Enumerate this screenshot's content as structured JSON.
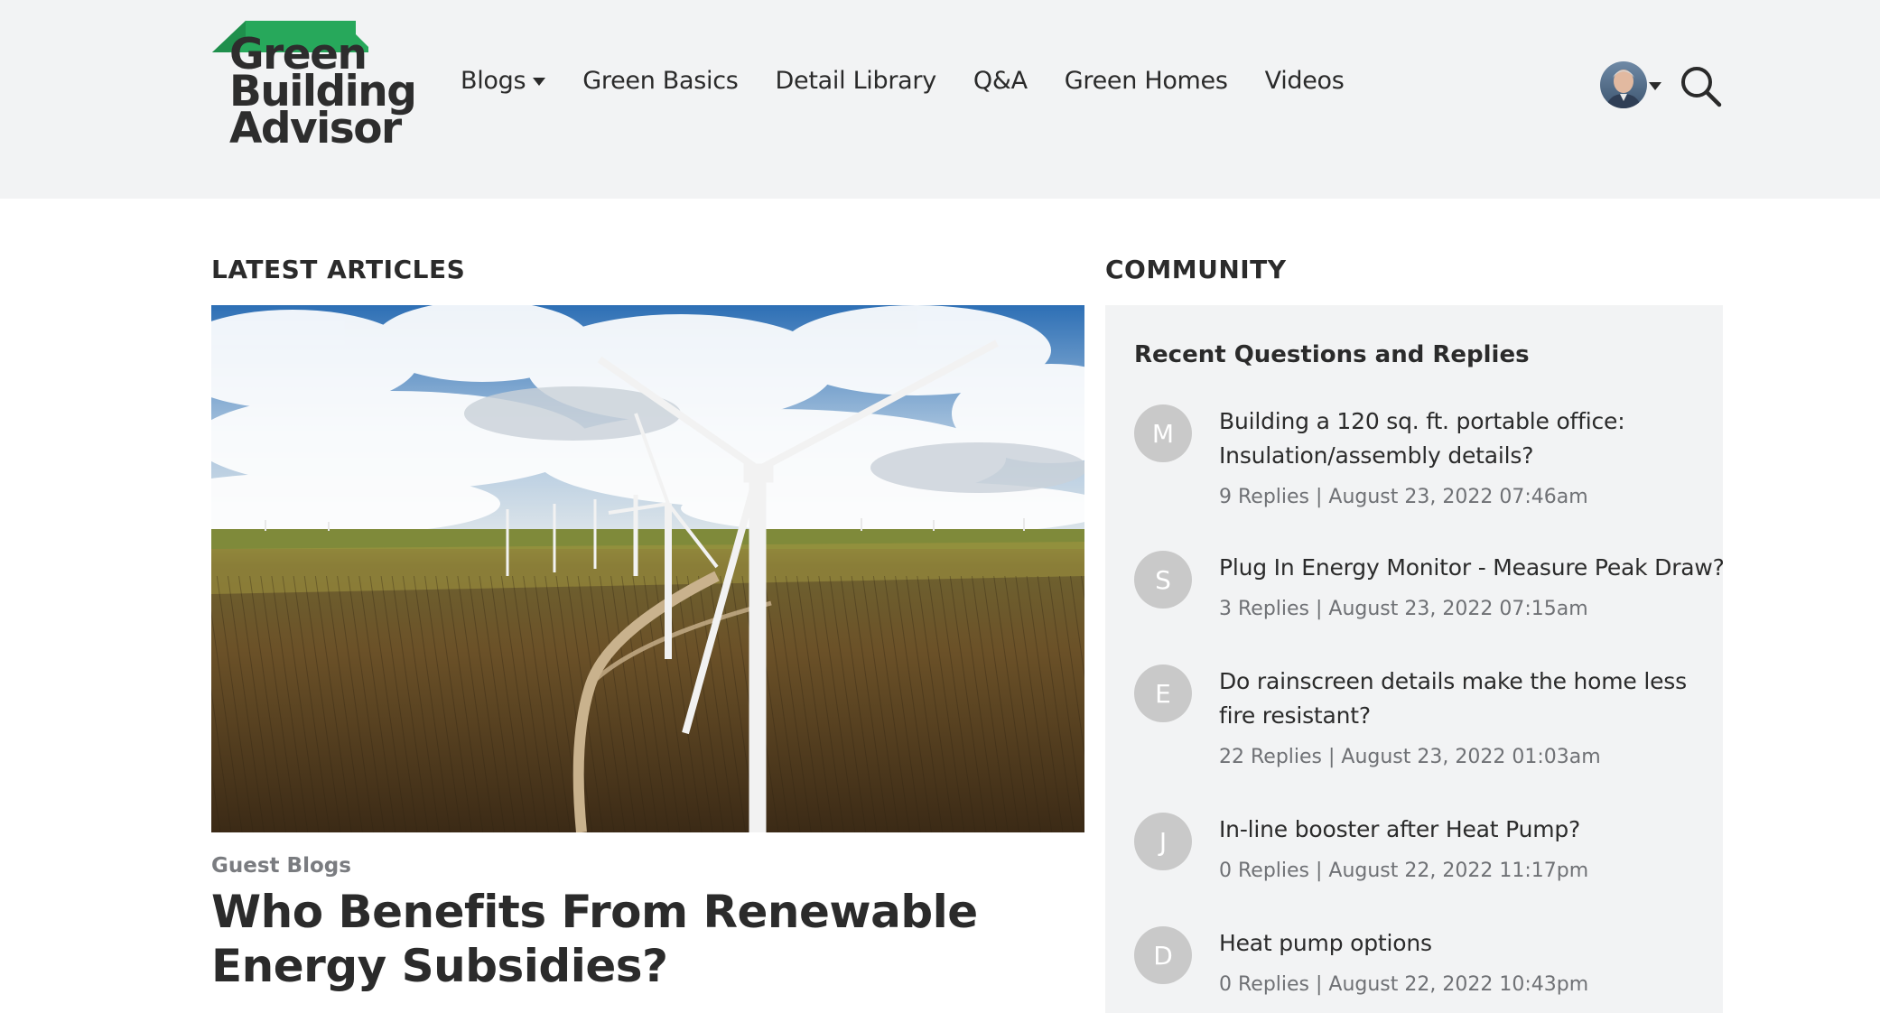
{
  "logo": {
    "line1": "Green",
    "line2": "Building",
    "line3": "Advisor",
    "roof_color": "#27a85b"
  },
  "nav": {
    "items": [
      {
        "label": "Blogs",
        "has_dropdown": true
      },
      {
        "label": "Green Basics"
      },
      {
        "label": "Detail Library"
      },
      {
        "label": "Q&A"
      },
      {
        "label": "Green Homes"
      },
      {
        "label": "Videos"
      }
    ]
  },
  "header_icons": {
    "avatar": "user-avatar",
    "search": "search-icon"
  },
  "latest": {
    "heading": "LATEST ARTICLES",
    "featured": {
      "category": "Guest Blogs",
      "title": "Who Benefits From Renewable Energy Subsidies?"
    }
  },
  "community": {
    "heading": "COMMUNITY",
    "subheading": "Recent Questions and Replies",
    "questions": [
      {
        "initial": "M",
        "title": "Building a 120 sq. ft. portable office: Insulation/assembly details?",
        "meta": "9 Replies | August 23, 2022 07:46am"
      },
      {
        "initial": "S",
        "title": "Plug In Energy Monitor - Measure Peak Draw?",
        "meta": "3 Replies | August 23, 2022 07:15am"
      },
      {
        "initial": "E",
        "title": "Do rainscreen details make the home less fire resistant?",
        "meta": "22 Replies | August 23, 2022 01:03am"
      },
      {
        "initial": "J",
        "title": "In-line booster after Heat Pump?",
        "meta": "0 Replies | August 22, 2022 11:17pm"
      },
      {
        "initial": "D",
        "title": "Heat pump options",
        "meta": "0 Replies | August 22, 2022 10:43pm"
      }
    ]
  },
  "colors": {
    "header_bg": "#f2f3f4",
    "text": "#2b2b2b",
    "muted": "#6f7175",
    "avatar_grey": "#c9c9c9"
  }
}
